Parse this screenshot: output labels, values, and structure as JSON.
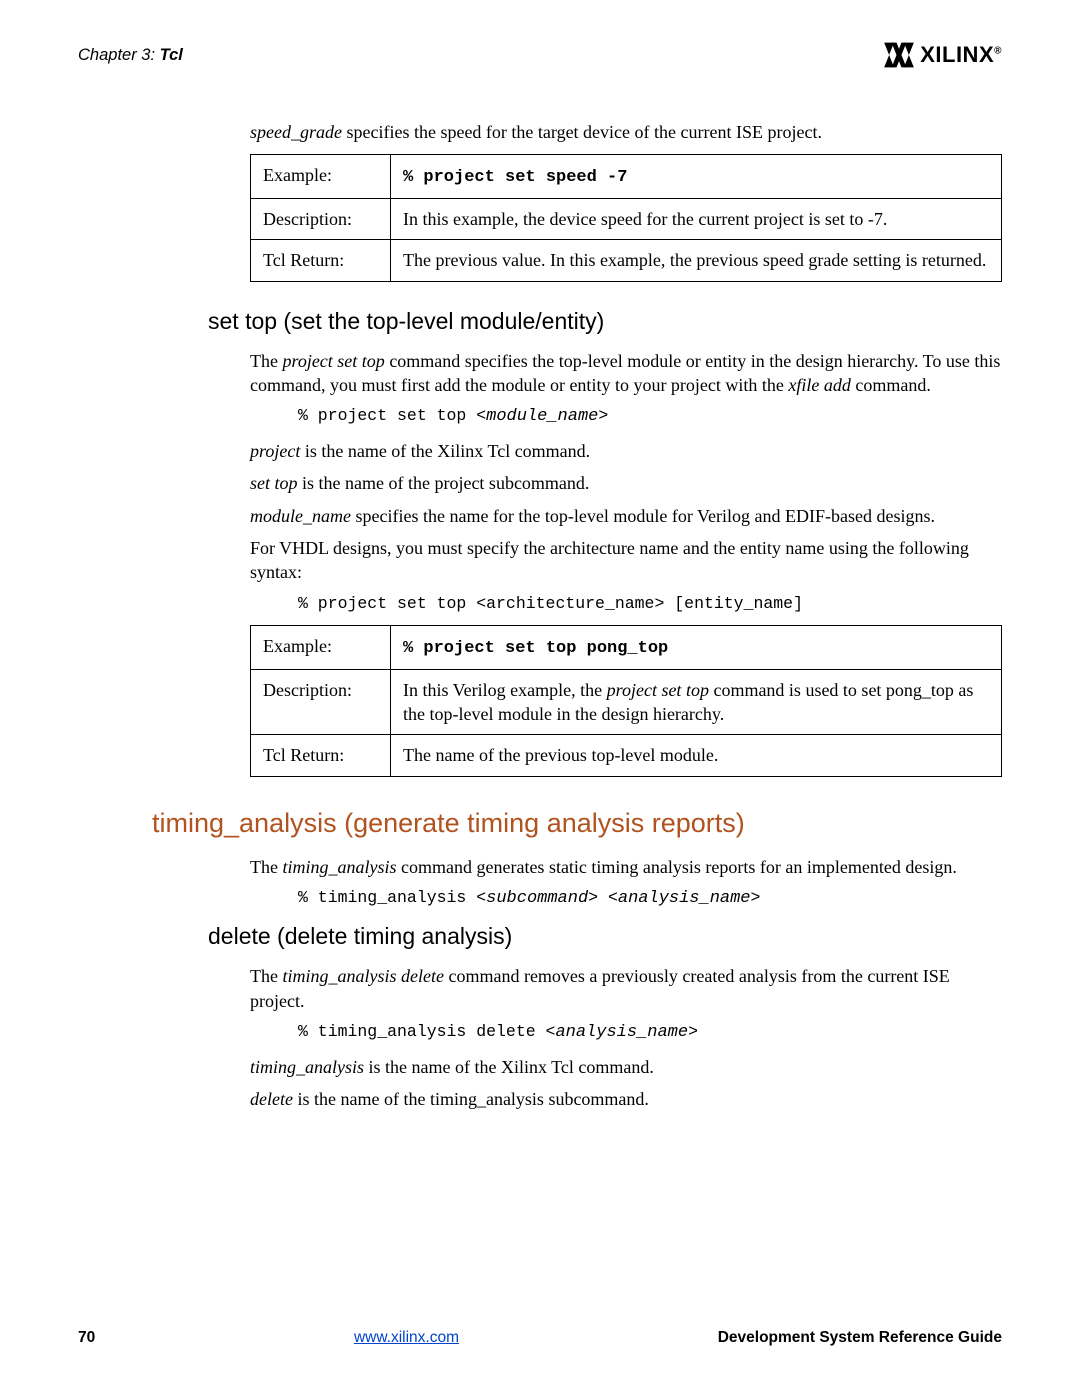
{
  "header": {
    "chapter_prefix": "Chapter 3:",
    "chapter_title": "Tcl",
    "brand": "XILINX",
    "reg": "®"
  },
  "speed_grade": {
    "intro_em": "speed_grade",
    "intro_rest": " specifies the speed for the target device of the current ISE project.",
    "table": {
      "example_label": "Example:",
      "example_code": "% project set speed -7",
      "desc_label": "Description:",
      "desc_text": "In this example, the device speed for the current project is set to -7.",
      "ret_label": "Tcl Return:",
      "ret_text": "The previous value. In this example, the previous speed grade setting is returned."
    }
  },
  "set_top": {
    "heading": "set top (set the top-level module/entity)",
    "p1_a": "The ",
    "p1_em1": "project set top",
    "p1_b": " command specifies the top-level module or entity in the design hierarchy. To use this command, you must first add the module or entity to your project with the ",
    "p1_em2": "xfile add",
    "p1_c": " command.",
    "code1_a": "% project set top <",
    "code1_em": "module_name",
    "code1_b": ">",
    "p2_em": "project",
    "p2_rest": " is the name of the Xilinx Tcl command.",
    "p3_em": "set top",
    "p3_rest": " is the name of the project subcommand.",
    "p4_em": "module_name",
    "p4_rest": " specifies the name for the top-level module for Verilog and EDIF-based designs.",
    "p5": "For VHDL designs, you must specify the architecture name and the entity name using the following syntax:",
    "code2": "% project set top <architecture_name> [entity_name]",
    "table": {
      "example_label": "Example:",
      "example_code": "% project set top pong_top",
      "desc_label": "Description:",
      "desc_a": "In this Verilog example, the ",
      "desc_em": "project set top",
      "desc_b": " command is used to set pong_top as the top-level module in the design hierarchy.",
      "ret_label": "Tcl Return:",
      "ret_text": "The name of the previous top-level module."
    }
  },
  "timing": {
    "heading": "timing_analysis (generate timing analysis reports)",
    "p1_a": "The ",
    "p1_em": "timing_analysis",
    "p1_b": " command generates static timing analysis reports for an implemented design.",
    "code1_a": "% timing_analysis <",
    "code1_em1": "subcommand",
    "code1_mid": "> <",
    "code1_em2": "analysis_name",
    "code1_end": ">"
  },
  "delete": {
    "heading": "delete (delete timing analysis)",
    "p1_a": "The ",
    "p1_em": "timing_analysis delete",
    "p1_b": " command removes a previously created analysis from the current ISE project.",
    "code1_a": "% timing_analysis delete <",
    "code1_em": "analysis_name",
    "code1_b": ">",
    "p2_em": "timing_analysis",
    "p2_rest": " is the name of the Xilinx Tcl command.",
    "p3_em": "delete",
    "p3_rest": " is the name of the timing_analysis subcommand."
  },
  "footer": {
    "page": "70",
    "url": "www.xilinx.com",
    "guide": "Development System Reference Guide"
  }
}
